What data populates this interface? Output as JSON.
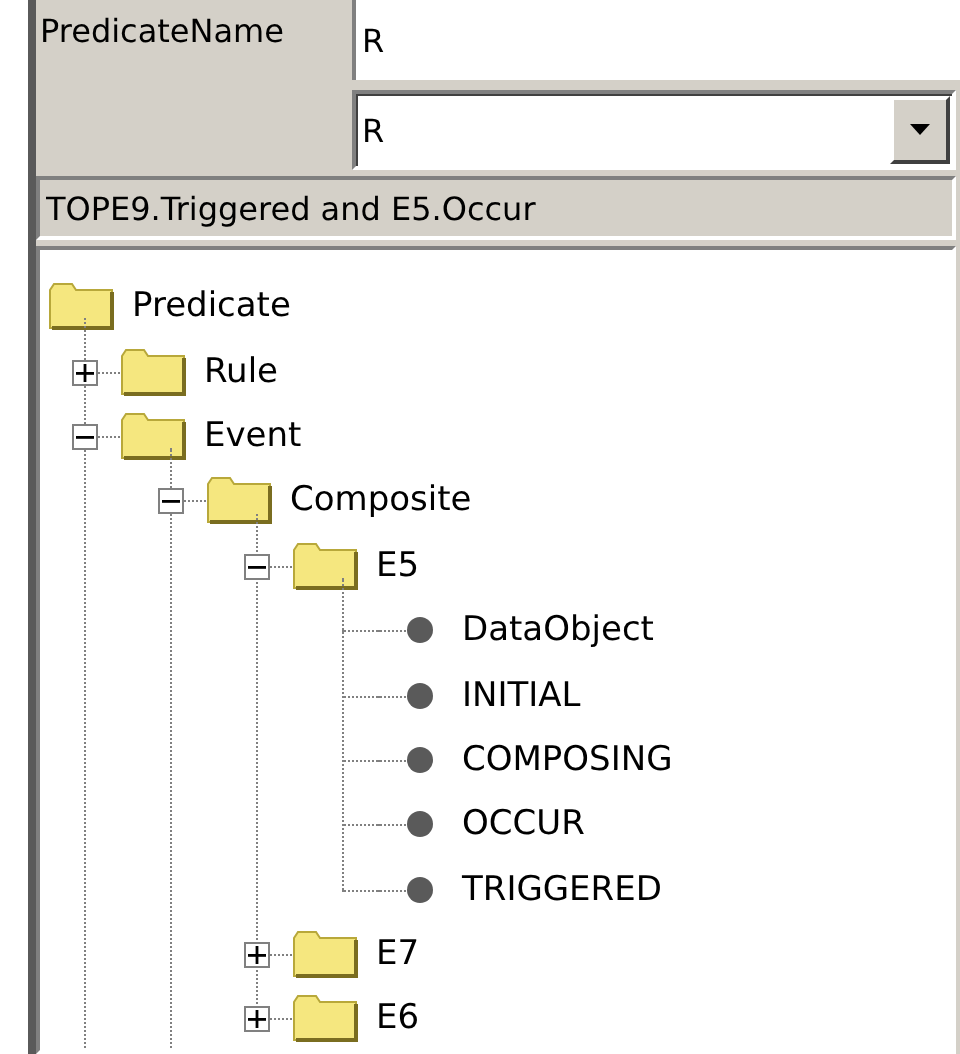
{
  "form": {
    "label": "PredicateName",
    "name_value": "R",
    "selection": "R",
    "expression": "TOPE9.Triggered and E5.Occur"
  },
  "tree": {
    "root": {
      "label": "Predicate",
      "kind": "folder",
      "children": [
        {
          "label": "Rule",
          "kind": "folder",
          "expanded": false
        },
        {
          "label": "Event",
          "kind": "folder",
          "expanded": true,
          "children": [
            {
              "label": "Composite",
              "kind": "folder",
              "expanded": true,
              "children": [
                {
                  "label": "E5",
                  "kind": "folder",
                  "expanded": true,
                  "children": [
                    {
                      "label": "DataObject",
                      "kind": "leaf"
                    },
                    {
                      "label": "INITIAL",
                      "kind": "leaf"
                    },
                    {
                      "label": "COMPOSING",
                      "kind": "leaf"
                    },
                    {
                      "label": "OCCUR",
                      "kind": "leaf"
                    },
                    {
                      "label": "TRIGGERED",
                      "kind": "leaf"
                    }
                  ]
                },
                {
                  "label": "E7",
                  "kind": "folder",
                  "expanded": false
                },
                {
                  "label": "E6",
                  "kind": "folder",
                  "expanded": false
                }
              ]
            }
          ]
        }
      ]
    }
  }
}
